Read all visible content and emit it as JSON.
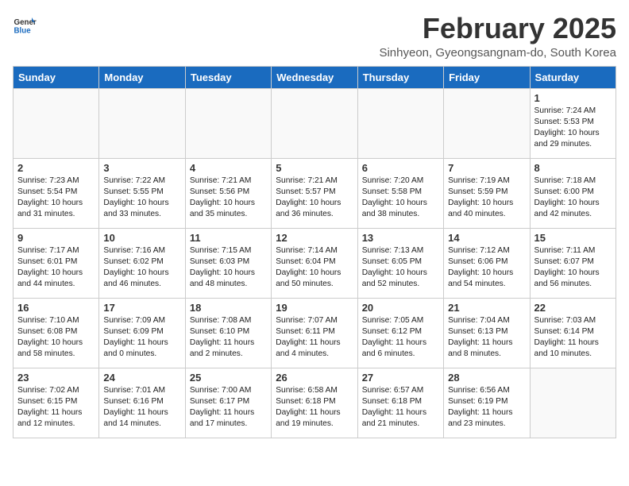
{
  "header": {
    "logo_line1": "General",
    "logo_line2": "Blue",
    "month": "February 2025",
    "location": "Sinhyeon, Gyeongsangnam-do, South Korea"
  },
  "weekdays": [
    "Sunday",
    "Monday",
    "Tuesday",
    "Wednesday",
    "Thursday",
    "Friday",
    "Saturday"
  ],
  "weeks": [
    [
      {
        "day": "",
        "info": ""
      },
      {
        "day": "",
        "info": ""
      },
      {
        "day": "",
        "info": ""
      },
      {
        "day": "",
        "info": ""
      },
      {
        "day": "",
        "info": ""
      },
      {
        "day": "",
        "info": ""
      },
      {
        "day": "1",
        "info": "Sunrise: 7:24 AM\nSunset: 5:53 PM\nDaylight: 10 hours\nand 29 minutes."
      }
    ],
    [
      {
        "day": "2",
        "info": "Sunrise: 7:23 AM\nSunset: 5:54 PM\nDaylight: 10 hours\nand 31 minutes."
      },
      {
        "day": "3",
        "info": "Sunrise: 7:22 AM\nSunset: 5:55 PM\nDaylight: 10 hours\nand 33 minutes."
      },
      {
        "day": "4",
        "info": "Sunrise: 7:21 AM\nSunset: 5:56 PM\nDaylight: 10 hours\nand 35 minutes."
      },
      {
        "day": "5",
        "info": "Sunrise: 7:21 AM\nSunset: 5:57 PM\nDaylight: 10 hours\nand 36 minutes."
      },
      {
        "day": "6",
        "info": "Sunrise: 7:20 AM\nSunset: 5:58 PM\nDaylight: 10 hours\nand 38 minutes."
      },
      {
        "day": "7",
        "info": "Sunrise: 7:19 AM\nSunset: 5:59 PM\nDaylight: 10 hours\nand 40 minutes."
      },
      {
        "day": "8",
        "info": "Sunrise: 7:18 AM\nSunset: 6:00 PM\nDaylight: 10 hours\nand 42 minutes."
      }
    ],
    [
      {
        "day": "9",
        "info": "Sunrise: 7:17 AM\nSunset: 6:01 PM\nDaylight: 10 hours\nand 44 minutes."
      },
      {
        "day": "10",
        "info": "Sunrise: 7:16 AM\nSunset: 6:02 PM\nDaylight: 10 hours\nand 46 minutes."
      },
      {
        "day": "11",
        "info": "Sunrise: 7:15 AM\nSunset: 6:03 PM\nDaylight: 10 hours\nand 48 minutes."
      },
      {
        "day": "12",
        "info": "Sunrise: 7:14 AM\nSunset: 6:04 PM\nDaylight: 10 hours\nand 50 minutes."
      },
      {
        "day": "13",
        "info": "Sunrise: 7:13 AM\nSunset: 6:05 PM\nDaylight: 10 hours\nand 52 minutes."
      },
      {
        "day": "14",
        "info": "Sunrise: 7:12 AM\nSunset: 6:06 PM\nDaylight: 10 hours\nand 54 minutes."
      },
      {
        "day": "15",
        "info": "Sunrise: 7:11 AM\nSunset: 6:07 PM\nDaylight: 10 hours\nand 56 minutes."
      }
    ],
    [
      {
        "day": "16",
        "info": "Sunrise: 7:10 AM\nSunset: 6:08 PM\nDaylight: 10 hours\nand 58 minutes."
      },
      {
        "day": "17",
        "info": "Sunrise: 7:09 AM\nSunset: 6:09 PM\nDaylight: 11 hours\nand 0 minutes."
      },
      {
        "day": "18",
        "info": "Sunrise: 7:08 AM\nSunset: 6:10 PM\nDaylight: 11 hours\nand 2 minutes."
      },
      {
        "day": "19",
        "info": "Sunrise: 7:07 AM\nSunset: 6:11 PM\nDaylight: 11 hours\nand 4 minutes."
      },
      {
        "day": "20",
        "info": "Sunrise: 7:05 AM\nSunset: 6:12 PM\nDaylight: 11 hours\nand 6 minutes."
      },
      {
        "day": "21",
        "info": "Sunrise: 7:04 AM\nSunset: 6:13 PM\nDaylight: 11 hours\nand 8 minutes."
      },
      {
        "day": "22",
        "info": "Sunrise: 7:03 AM\nSunset: 6:14 PM\nDaylight: 11 hours\nand 10 minutes."
      }
    ],
    [
      {
        "day": "23",
        "info": "Sunrise: 7:02 AM\nSunset: 6:15 PM\nDaylight: 11 hours\nand 12 minutes."
      },
      {
        "day": "24",
        "info": "Sunrise: 7:01 AM\nSunset: 6:16 PM\nDaylight: 11 hours\nand 14 minutes."
      },
      {
        "day": "25",
        "info": "Sunrise: 7:00 AM\nSunset: 6:17 PM\nDaylight: 11 hours\nand 17 minutes."
      },
      {
        "day": "26",
        "info": "Sunrise: 6:58 AM\nSunset: 6:18 PM\nDaylight: 11 hours\nand 19 minutes."
      },
      {
        "day": "27",
        "info": "Sunrise: 6:57 AM\nSunset: 6:18 PM\nDaylight: 11 hours\nand 21 minutes."
      },
      {
        "day": "28",
        "info": "Sunrise: 6:56 AM\nSunset: 6:19 PM\nDaylight: 11 hours\nand 23 minutes."
      },
      {
        "day": "",
        "info": ""
      }
    ]
  ]
}
